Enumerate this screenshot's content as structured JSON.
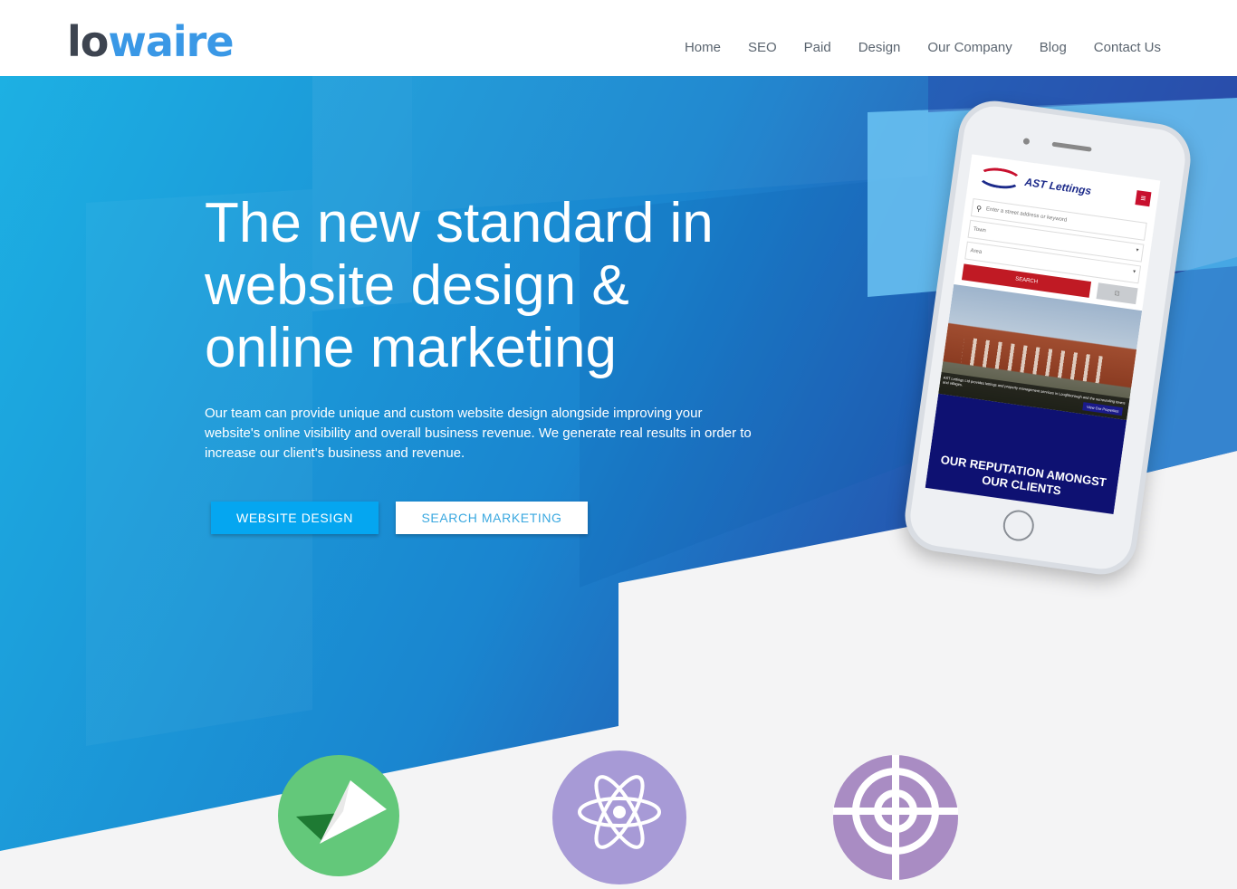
{
  "brand": {
    "logo_part1": "lo",
    "logo_part2": "waire",
    "colors": {
      "dark": "#3d4450",
      "accent": "#3a98e6"
    }
  },
  "nav": {
    "items": [
      {
        "label": "Home"
      },
      {
        "label": "SEO"
      },
      {
        "label": "Paid"
      },
      {
        "label": "Design"
      },
      {
        "label": "Our Company"
      },
      {
        "label": "Blog"
      },
      {
        "label": "Contact Us"
      }
    ]
  },
  "hero": {
    "headline": "The new standard in website design & online marketing",
    "lead": "Our team can provide unique and custom website design alongside improving your website's online visibility and overall business revenue. We generate real results in order to increase our client's business and revenue.",
    "primary_button": "WEBSITE DESIGN",
    "secondary_button": "SEARCH MARKETING"
  },
  "phone_screen": {
    "brand": "AST Lettings",
    "menu_icon": "hamburger-icon",
    "search_placeholder": "Enter a street address or keyword",
    "town_field": "Town",
    "area_field": "Area",
    "search_button": "SEARCH",
    "photo_caption": "AST Lettings Ltd provides lettings and property management services in Loughborough and the surrounding towns and villages.",
    "view_button": "View Our Properties",
    "reputation_heading": "OUR REPUTATION AMONGST OUR CLIENTS"
  },
  "features": [
    {
      "icon": "paper-plane-icon",
      "color": "#63c87a"
    },
    {
      "icon": "atom-icon",
      "color": "#a79ad6"
    },
    {
      "icon": "target-icon",
      "color": "#a98cc3"
    }
  ]
}
